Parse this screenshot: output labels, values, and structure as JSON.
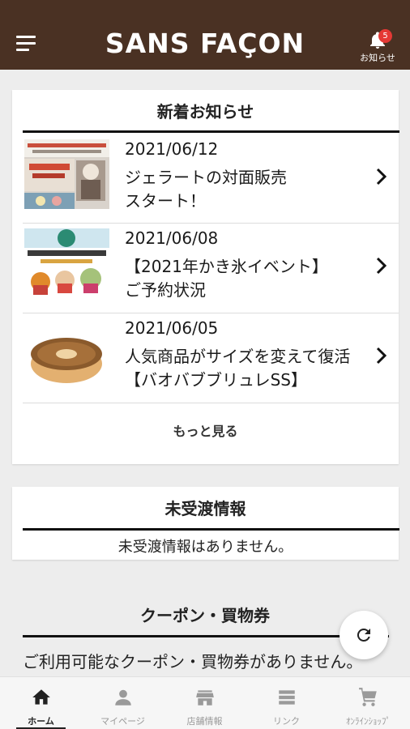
{
  "header": {
    "logo": "SANS FAÇON",
    "notification_count": "5",
    "notification_label": "お知らせ"
  },
  "news": {
    "title": "新着お知らせ",
    "items": [
      {
        "date": "2021/06/12",
        "line1": "ジェラートの対面販売",
        "line2": "スタート！"
      },
      {
        "date": "2021/06/08",
        "line1": "【2021年かき氷イベント】",
        "line2": "ご予約状況"
      },
      {
        "date": "2021/06/05",
        "line1": "人気商品がサイズを変えて復活",
        "line2": "【バオバブブリュレSS】"
      }
    ],
    "more_label": "もっと見る"
  },
  "undelivered": {
    "title": "未受渡情報",
    "message": "未受渡情報はありません。"
  },
  "coupon": {
    "title": "クーポン・買物券",
    "message": "ご利用可能なクーポン・買物券がありません。"
  },
  "bottom_nav": [
    {
      "label": "ホーム",
      "icon": "home-icon",
      "active": true
    },
    {
      "label": "マイページ",
      "icon": "person-icon",
      "active": false
    },
    {
      "label": "店舗情報",
      "icon": "store-icon",
      "active": false
    },
    {
      "label": "リンク",
      "icon": "list-icon",
      "active": false
    },
    {
      "label": "ｵﾝﾗｲﾝｼｮｯﾌﾟ",
      "icon": "cart-icon",
      "active": false
    }
  ],
  "colors": {
    "header_bg": "#4a3123",
    "badge": "#e53935",
    "background": "#ededed"
  }
}
